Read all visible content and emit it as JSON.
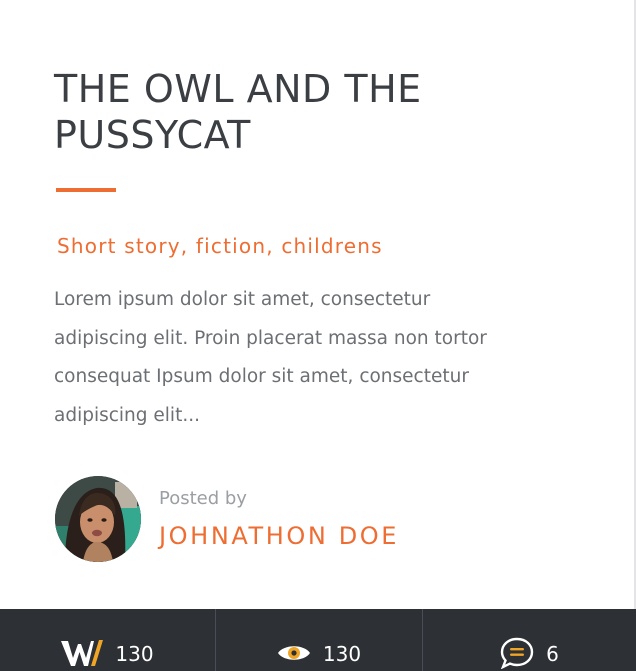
{
  "article": {
    "title_line1": "THE OWL AND THE",
    "title_line2": "PUSSYCAT",
    "tags": "Short story, fiction, childrens",
    "excerpt_lines": [
      "Lorem ipsum dolor sit amet, consectetur",
      "adipiscing elit. Proin placerat massa non tortor",
      "consequat Ipsum dolor sit amet, consectetur",
      "adipiscing elit..."
    ]
  },
  "author": {
    "posted_by_label": "Posted by",
    "name": "JOHNATHON DOE",
    "avatar_icon": "user-avatar-photo"
  },
  "stats": [
    {
      "icon": "wordpress-w-icon",
      "value": "130"
    },
    {
      "icon": "eye-icon",
      "value": "130"
    },
    {
      "icon": "comment-bubble-icon",
      "value": "6"
    }
  ],
  "colors": {
    "accent": "#ee6d32",
    "title": "#3b3f44",
    "body_text": "#6c6f73",
    "muted_text": "#9b9ea2",
    "stats_bar_bg": "#2d3035",
    "stats_icon_orange": "#f0a526"
  }
}
